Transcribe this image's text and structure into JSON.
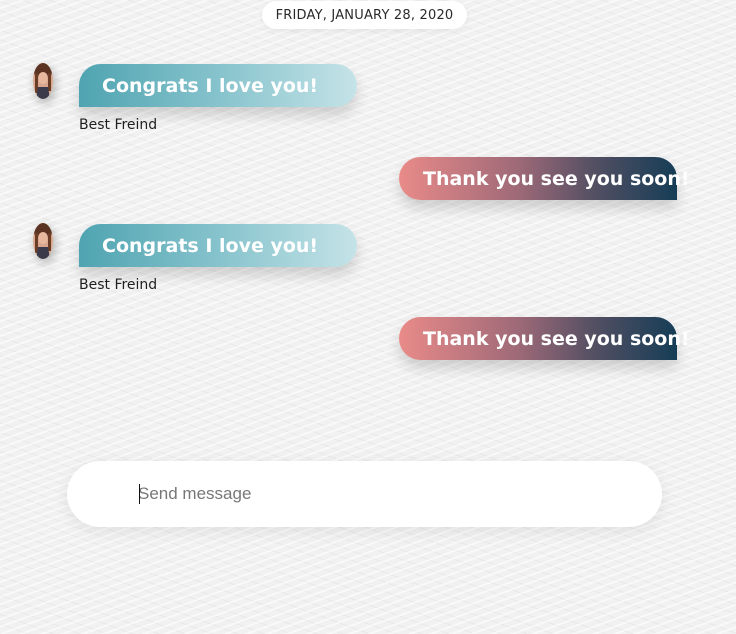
{
  "chat": {
    "date_divider": "FRIDAY, JANUARY 28, 2020",
    "messages": [
      {
        "direction": "incoming",
        "text": "Congrats I love you!",
        "sender": "Best Freind"
      },
      {
        "direction": "outgoing",
        "text": "Thank you see you soon!"
      },
      {
        "direction": "incoming",
        "text": "Congrats I love you!",
        "sender": "Best Freind"
      },
      {
        "direction": "outgoing",
        "text": "Thank you see you soon!"
      }
    ]
  },
  "composer": {
    "value": "",
    "placeholder": "Send message"
  },
  "colors": {
    "incoming_gradient": [
      "#4fa4b1",
      "#c5e3e8"
    ],
    "outgoing_gradient": [
      "#e98b89",
      "#153d56"
    ]
  }
}
